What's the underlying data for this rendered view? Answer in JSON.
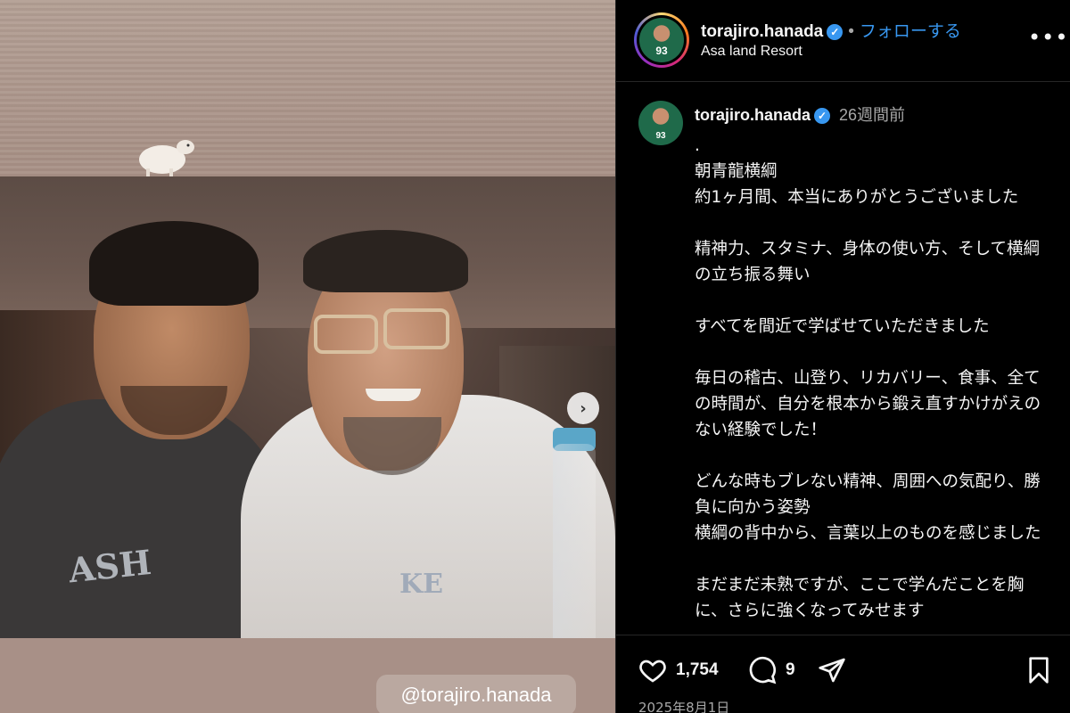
{
  "media": {
    "watermark": "@torajiro.hanada",
    "next_icon": "chevron-right-icon",
    "shirt_print_left": "ASH",
    "shirt_print_right": "KE"
  },
  "header": {
    "username": "torajiro.hanada",
    "verified_icon": "verified-badge-icon",
    "separator": "•",
    "follow_label": "フォローする",
    "location": "Asa land Resort",
    "more_label": "•••",
    "avatar_number": "93"
  },
  "caption": {
    "username": "torajiro.hanada",
    "time_ago": "26週間前",
    "avatar_number": "93",
    "text": ".\n朝青龍横綱\n約1ヶ月間、本当にありがとうございました\n\n精神力、スタミナ、身体の使い方、そして横綱の立ち振る舞い\n\nすべてを間近で学ばせていただきました\n\n毎日の稽古、山登り、リカバリー、食事、全ての時間が、自分を根本から鍛え直すかけがえのない経験でした！\n\nどんな時もブレない精神、周囲への気配り、勝負に向かう姿勢\n横綱の背中から、言葉以上のものを感じました\n\nまだまだ未熟ですが、ここで学んだことを胸に、さらに強くなってみせます"
  },
  "actions": {
    "like_count": "1,754",
    "comment_count": "9",
    "icons": [
      "heart-icon",
      "comment-icon",
      "share-icon",
      "bookmark-icon"
    ]
  },
  "footer": {
    "date": "2025年8月1日"
  },
  "colors": {
    "accent": "#3897f0",
    "background": "#000000",
    "muted": "#a8a8a8"
  }
}
